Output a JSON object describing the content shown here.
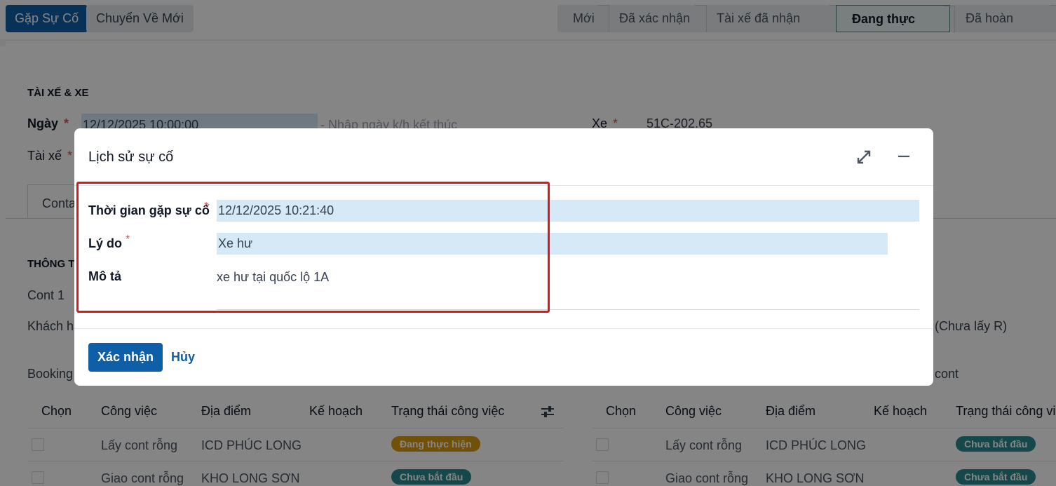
{
  "topbar": {
    "incident_button": "Gặp Sự Cố",
    "reset_button": "Chuyển Về Mới",
    "stages": [
      "Mới",
      "Đã xác nhận",
      "Tài xế đã nhận lệnh",
      "Đang thực hiện",
      "Đã hoàn thành"
    ],
    "active_stage": "Đang thực hiện"
  },
  "form": {
    "section_driver": "TÀI XẾ & XE",
    "date_label": "Ngày",
    "date_value": "12/12/2025 10:00:00",
    "date_end_placeholder": "- Nhập ngày k/h kết thúc",
    "vehicle_label": "Xe",
    "vehicle_value": "51C-202.65",
    "driver_label": "Tài xế",
    "tab_label": "Conta",
    "section_info": "THÔNG T",
    "cont_label": "Cont 1",
    "customer_label": "Khách ha",
    "booking_label": "Booking",
    "right_partial_1": "(Chưa lấy R)",
    "right_partial_2": "cont",
    "required_mark": "*"
  },
  "table_left": {
    "headers": [
      "Chọn",
      "Công việc",
      "Địa điểm",
      "Kế hoạch",
      "Trạng thái công việc"
    ],
    "rows": [
      {
        "task": "Lấy cont rỗng",
        "place": "ICD PHÚC LONG",
        "status": "Đang thực hiện"
      },
      {
        "task": "Giao cont rỗng",
        "place": "KHO LONG SƠN",
        "status": "Chưa bắt đầu"
      }
    ]
  },
  "table_right": {
    "headers": [
      "Chọn",
      "Công việc",
      "Địa điểm",
      "Kế hoạch",
      "Trạng thái công vi"
    ],
    "rows": [
      {
        "task": "Lấy cont rỗng",
        "place": "ICD PHÚC LONG",
        "status": "Chưa bắt đầu"
      },
      {
        "task": "Giao cont rỗng",
        "place": "KHO LONG SƠN",
        "status": "Chưa bắt đầu"
      }
    ]
  },
  "modal": {
    "title": "Lịch sử sự cố",
    "time_label": "Thời gian gặp sự cố",
    "time_value": "12/12/2025 10:21:40",
    "reason_label": "Lý do",
    "reason_value": "Xe hư",
    "desc_label": "Mô tả",
    "desc_value": "xe hư tại quốc lộ 1A",
    "required_mark": "*",
    "confirm_button": "Xác nhận",
    "cancel_button": "Hủy"
  },
  "colors": {
    "primary": "#0f5ea8",
    "highlight_field": "#d5e9f7",
    "annotation_red": "#e0141b",
    "badge_in_progress": "#d99a14",
    "badge_not_started": "#2a8a8f"
  }
}
